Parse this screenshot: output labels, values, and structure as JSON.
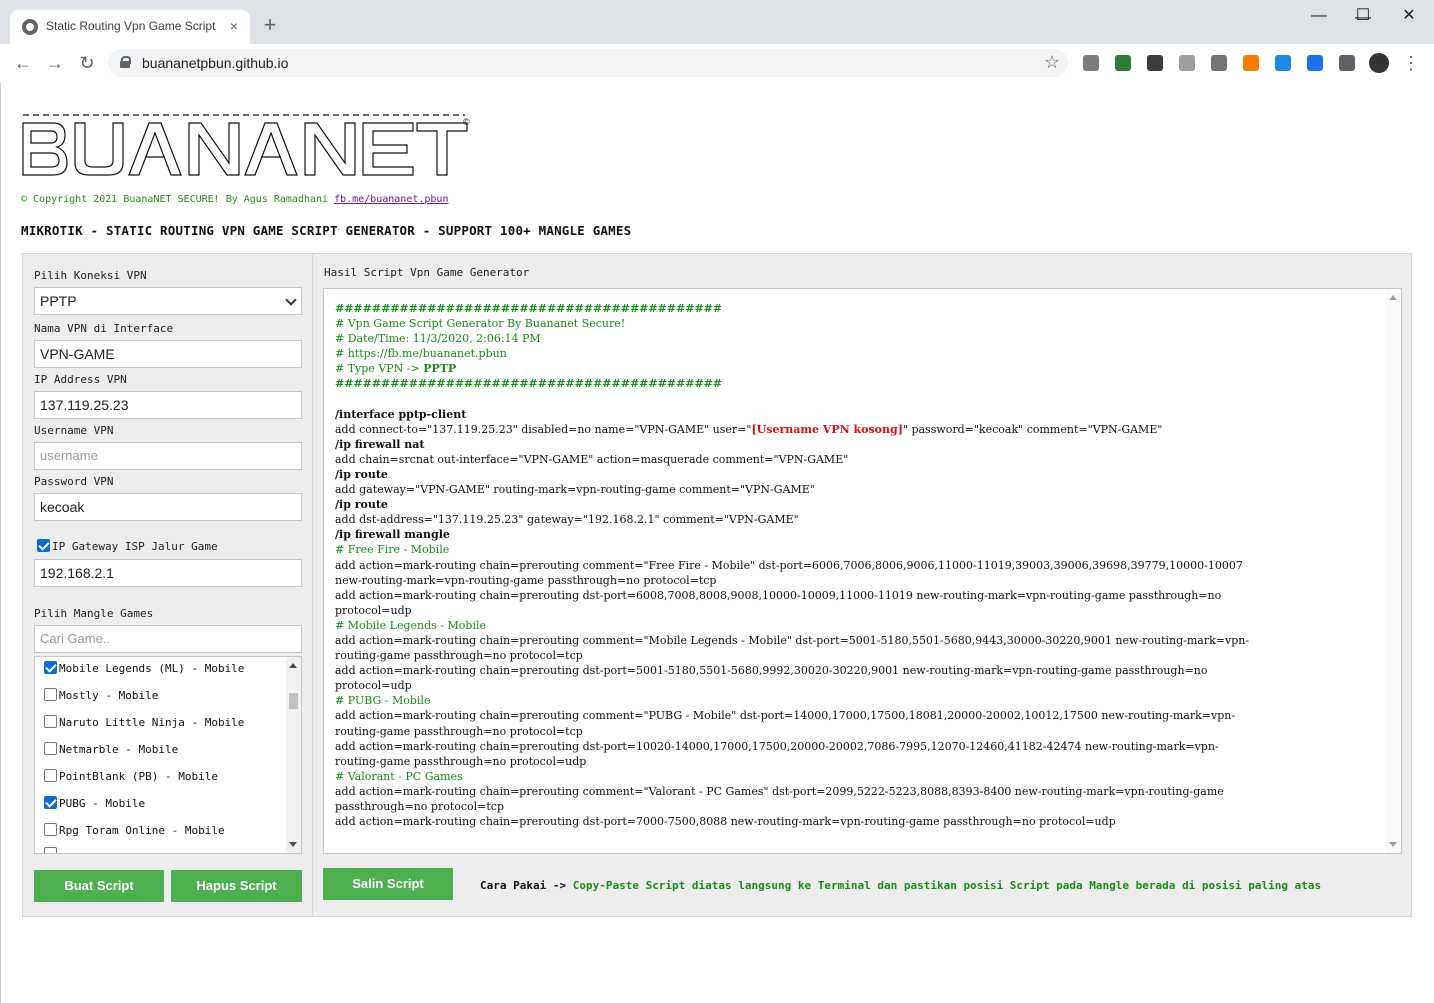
{
  "browser": {
    "tab_title": "Static Routing Vpn Game Script G",
    "tab_close": "×",
    "new_tab": "+",
    "url": "buananetpbun.github.io",
    "window_controls": {
      "minimize": "—",
      "maximize": "☐",
      "close": "✕"
    },
    "nav": {
      "back": "←",
      "forward": "→",
      "reload": "↻",
      "star": "☆",
      "menu": "⋮"
    },
    "extensions": [
      {
        "icon": "ext-calc-icon",
        "color": "#7d7d7d"
      },
      {
        "icon": "ext-chart-icon",
        "color": "#2e7d32"
      },
      {
        "icon": "ext-bitwarden-icon",
        "color": "#3c3c3c"
      },
      {
        "icon": "ext-s-icon",
        "color": "#9e9e9e"
      },
      {
        "icon": "ext-gear-icon",
        "color": "#757575"
      },
      {
        "icon": "ext-rss-icon",
        "color": "#f57c00"
      },
      {
        "icon": "ext-folder-icon",
        "color": "#1e88e5"
      },
      {
        "icon": "ext-zoom-icon",
        "color": "#1a73e8"
      },
      {
        "icon": "ext-puzzle-icon",
        "color": "#5f6368"
      }
    ]
  },
  "header": {
    "copyright": "© Copyright 2021 BuanaNET SECURE! By Agus Ramadhani",
    "copyright_link": "fb.me/buananet.pbun",
    "headline": "MIKROTIK - STATIC ROUTING VPN GAME SCRIPT GENERATOR - SUPPORT 100+ MANGLE GAMES"
  },
  "form": {
    "vpn_conn_label": "Pilih Koneksi VPN",
    "vpn_conn_value": "PPTP",
    "vpn_name_label": "Nama VPN di Interface",
    "vpn_name_value": "VPN-GAME",
    "ip_label": "IP Address VPN",
    "ip_value": "137.119.25.23",
    "user_label": "Username VPN",
    "user_placeholder": "username",
    "pass_label": "Password VPN",
    "pass_value": "kecoak",
    "gateway_label": "IP Gateway ISP Jalur Game",
    "gateway_checked": true,
    "gateway_value": "192.168.2.1",
    "mangle_label": "Pilih Mangle Games",
    "search_placeholder": "Cari Game..",
    "games": [
      {
        "label": "Mobile Legends (ML) - Mobile",
        "checked": true
      },
      {
        "label": "Mostly - Mobile",
        "checked": false
      },
      {
        "label": "Naruto Little Ninja - Mobile",
        "checked": false
      },
      {
        "label": "Netmarble - Mobile",
        "checked": false
      },
      {
        "label": "PointBlank (PB) - Mobile",
        "checked": false
      },
      {
        "label": "PUBG - Mobile",
        "checked": true
      },
      {
        "label": "Rpg Toram Online - Mobile",
        "checked": false
      }
    ],
    "btn_create": "Buat Script",
    "btn_delete": "Hapus Script"
  },
  "result": {
    "title": "Hasil Script Vpn Game Generator",
    "hash_line": "##########################################",
    "comment_title": "# Vpn Game Script Generator By Buananet Secure!",
    "comment_date": "# Date/Time: 11/3/2020, 2:06:14 PM",
    "comment_url": "# https://fb.me/buananet.pbun",
    "comment_type_prefix": "# Type VPN -> ",
    "comment_type_value": "PPTP",
    "cmd_interface": "/interface pptp-client",
    "add_client_a": "add connect-to=\"137.119.25.23\" disabled=no name=\"VPN-GAME\" user=\"",
    "add_client_user": "[Username VPN kosong]",
    "add_client_b": "\" password=\"kecoak\" comment=\"VPN-GAME\"",
    "cmd_nat": "/ip firewall nat",
    "add_nat": "add chain=srcnat out-interface=\"VPN-GAME\" action=masquerade comment=\"VPN-GAME\"",
    "cmd_route": "/ip route",
    "add_route1": "add gateway=\"VPN-GAME\" routing-mark=vpn-routing-game comment=\"VPN-GAME\"",
    "add_route2": "add dst-address=\"137.119.25.23\" gateway=\"192.168.2.1\" comment=\"VPN-GAME\"",
    "cmd_mangle": "/ip firewall mangle",
    "ff_comment": "# Free Fire - Mobile",
    "ff_tcp_1": "add action=mark-routing chain=prerouting comment=\"Free Fire - Mobile\" dst-port=6006,7006,8006,9006,11000-11019,39003,39006,39698,39779,10000-10007",
    "ff_tcp_2": "new-routing-mark=vpn-routing-game passthrough=no protocol=tcp",
    "ff_udp_1": "add action=mark-routing chain=prerouting dst-port=6008,7008,8008,9008,10000-10009,11000-11019 new-routing-mark=vpn-routing-game passthrough=no",
    "ff_udp_2": "protocol=udp",
    "ml_comment": "# Mobile Legends - Mobile",
    "ml_tcp_1": "add action=mark-routing chain=prerouting comment=\"Mobile Legends - Mobile\" dst-port=5001-5180,5501-5680,9443,30000-30220,9001 new-routing-mark=vpn-",
    "ml_tcp_2": "routing-game passthrough=no protocol=tcp",
    "ml_udp_1": "add action=mark-routing chain=prerouting dst-port=5001-5180,5501-5680,9992,30020-30220,9001 new-routing-mark=vpn-routing-game passthrough=no",
    "ml_udp_2": "protocol=udp",
    "pubg_comment": "# PUBG - Mobile",
    "pubg_tcp_1": "add action=mark-routing chain=prerouting comment=\"PUBG - Mobile\" dst-port=14000,17000,17500,18081,20000-20002,10012,17500 new-routing-mark=vpn-",
    "pubg_tcp_2": "routing-game passthrough=no protocol=tcp",
    "pubg_udp_1": "add action=mark-routing chain=prerouting dst-port=10020-14000,17000,17500,20000-20002,7086-7995,12070-12460,41182-42474 new-routing-mark=vpn-",
    "pubg_udp_2": "routing-game passthrough=no protocol=udp",
    "val_comment": "# Valorant - PC Games",
    "val_tcp_1": "add action=mark-routing chain=prerouting comment=\"Valorant - PC Games\" dst-port=2099,5222-5223,8088,8393-8400 new-routing-mark=vpn-routing-game",
    "val_tcp_2": "passthrough=no protocol=tcp",
    "val_udp": "add action=mark-routing chain=prerouting dst-port=7000-7500,8088 new-routing-mark=vpn-routing-game passthrough=no protocol=udp",
    "btn_copy": "Salin Script",
    "usage_prefix": "Cara Pakai -> ",
    "usage_text": "Copy-Paste Script diatas langsung ke Terminal dan pastikan posisi Script pada Mangle berada di posisi paling atas"
  },
  "colors": {
    "button_green": "#4caf50",
    "comment_green": "#1a8c1a",
    "warning_red": "#e01010"
  }
}
